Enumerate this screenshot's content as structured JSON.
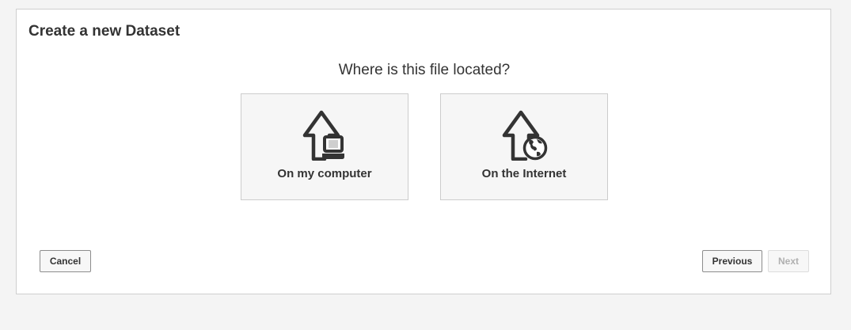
{
  "dialog": {
    "title": "Create a new Dataset",
    "question": "Where is this file located?"
  },
  "options": [
    {
      "label": "On my computer",
      "icon": "upload-from-computer-icon"
    },
    {
      "label": "On the Internet",
      "icon": "upload-from-internet-icon"
    }
  ],
  "buttons": {
    "cancel": "Cancel",
    "previous": "Previous",
    "next": "Next",
    "next_disabled": true
  },
  "colors": {
    "background": "#f4f4f4",
    "text": "#333333",
    "icon": "#333333",
    "disabled_text": "#b0b0b0"
  }
}
